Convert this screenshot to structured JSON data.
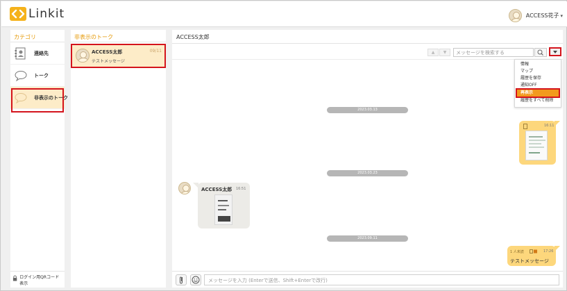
{
  "app": {
    "logo_text": "Linkit",
    "brand_color": "#f5b21b"
  },
  "header": {
    "user_name": "ACCESS花子",
    "caret": "▾"
  },
  "category": {
    "title": "カテゴリ",
    "items": [
      {
        "label": "連絡先",
        "icon": "contacts-icon"
      },
      {
        "label": "トーク",
        "icon": "speech-bubble-icon"
      },
      {
        "label": "非表示のトーク",
        "icon": "hidden-talk-icon"
      }
    ],
    "qr_label": "ログイン用QRコード表示"
  },
  "hidden_talks": {
    "title": "非表示のトーク",
    "items": [
      {
        "name": "ACCESS太郎",
        "date": "09/11",
        "preview": "テストメッセージ"
      }
    ]
  },
  "chat": {
    "title": "ACCESS太郎",
    "search_placeholder": "メッセージを検索する",
    "menu_items": [
      "情報",
      "マップ",
      "履歴を保存",
      "通知OFF",
      "再表示",
      "履歴をすべて削除"
    ],
    "dates": [
      "2023.03.13",
      "2023.03.23",
      "2023.09.11"
    ],
    "messages": [
      {
        "side": "right",
        "type": "image",
        "time": "16:11"
      },
      {
        "side": "left",
        "type": "image",
        "sender": "ACCESS太郎",
        "time": "16:51"
      },
      {
        "side": "right",
        "type": "text",
        "read": "1 人未読",
        "time": "17:26",
        "text": "テストメッセージ"
      }
    ],
    "composer_placeholder": "メッセージを入力 (Enterで送信、Shift+Enterで改行)"
  },
  "colors": {
    "highlight": "#d4141c",
    "accent": "#f29a1d",
    "bubble": "#fdd77c",
    "selected_bg": "#fdecc8"
  }
}
